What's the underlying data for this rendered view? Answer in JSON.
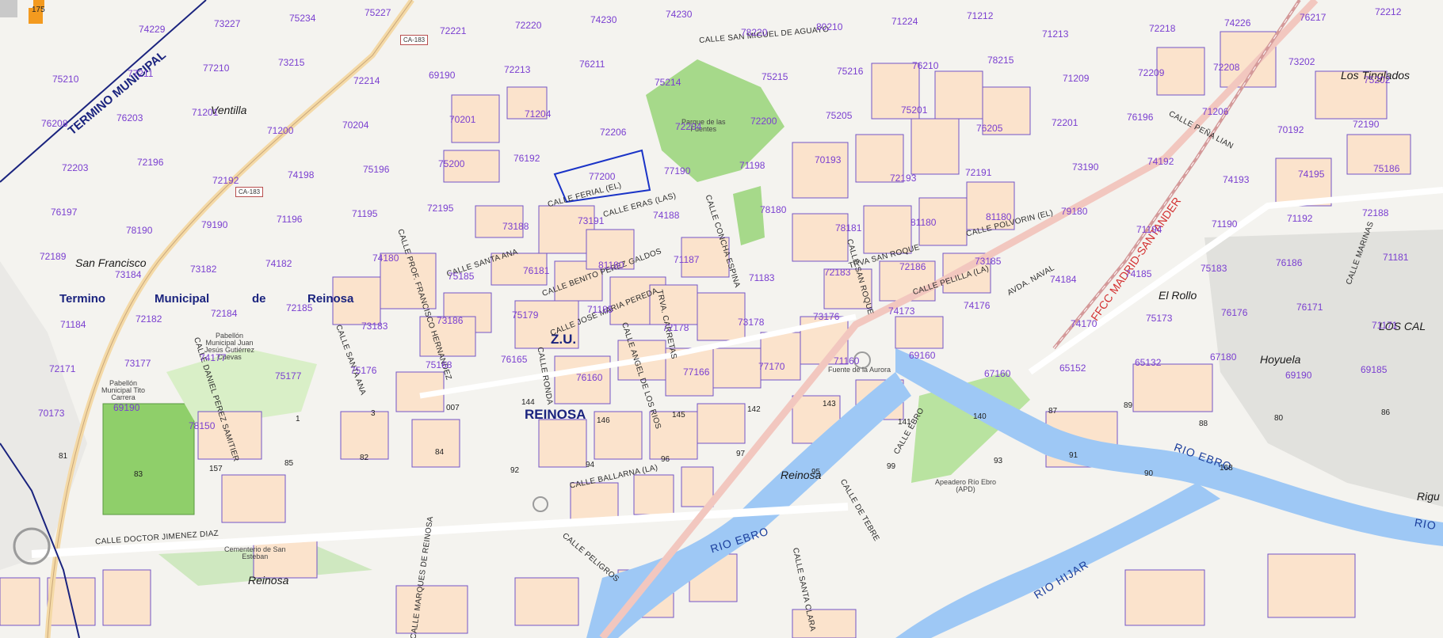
{
  "colors": {
    "background": "#f4f3ef",
    "block": "#fbe3cc",
    "block_stroke": "#7354c7",
    "river": "#9ec8f5",
    "road": "#f2c7bf",
    "park": "#a6d98a",
    "boundary": "#1a237e",
    "rail": "#d32f2f"
  },
  "icons": {
    "map_control": "layers-icon"
  },
  "labels": {
    "boundary": [
      {
        "text": "TERMINO  MUNICIPAL"
      },
      {
        "text": "Termino"
      },
      {
        "text": "Municipal"
      },
      {
        "text": "de"
      },
      {
        "text": "Reinosa"
      }
    ],
    "zones": [
      {
        "text": "Z.U."
      },
      {
        "text": "REINOSA"
      }
    ],
    "places": [
      {
        "text": "Ventilla"
      },
      {
        "text": "San Francisco"
      },
      {
        "text": "Los Tinglados"
      },
      {
        "text": "El Rollo"
      },
      {
        "text": "LOS CAL"
      },
      {
        "text": "Hoyuela"
      },
      {
        "text": "Reinosa"
      },
      {
        "text": "Reinosa"
      },
      {
        "text": "Rigu"
      }
    ],
    "pois": [
      {
        "text": "Parque de las\nFuentes"
      },
      {
        "text": "Pabellón\nMunicipal Juan\nJesús Gutiérrez\nCuevas"
      },
      {
        "text": "Pabellón\nMunicipal Tito\nCarrera"
      },
      {
        "text": "Cementerio de San\nEsteban"
      },
      {
        "text": "Apeadero Río Ebro\n(APD)"
      },
      {
        "text": "Fuente de la Aurora"
      }
    ],
    "rivers": [
      {
        "text": "RIO  EBRO"
      },
      {
        "text": "RIO  EBRO"
      },
      {
        "text": "RIO"
      },
      {
        "text": "RIO   HIJAR"
      },
      {
        "text": "RIO"
      }
    ],
    "rail": [
      {
        "text": "FFCC MADRID-SANTANDER"
      }
    ],
    "badges": [
      {
        "text": "CA-183"
      },
      {
        "text": "CA-183"
      }
    ],
    "streets": [
      {
        "text": "CALLE SAN MIGUEL DE AGUAYO"
      },
      {
        "text": "CALLE FERIAL (EL)"
      },
      {
        "text": "CALLE ERAS (LAS)"
      },
      {
        "text": "CALLE SANTA ANA"
      },
      {
        "text": "CALLE BENITO PEREZ GALDOS"
      },
      {
        "text": "CALLE JOSE MARIA PEREDA"
      },
      {
        "text": "CALLE CONCHA ESPINA"
      },
      {
        "text": "CALLE PROF. FRANCISCO HERNANDEZ"
      },
      {
        "text": "CALLE SANTA ANA"
      },
      {
        "text": "CALLE DANIEL PEREZ SAMITIER"
      },
      {
        "text": "CALLE RONDA"
      },
      {
        "text": "CALLE ANGEL DE LOS RIOS"
      },
      {
        "text": "TRVA. CARRETAS"
      },
      {
        "text": "CALLE SAN ROQUE"
      },
      {
        "text": "TRVA SAN ROQUE"
      },
      {
        "text": "CALLE PELILLA (LA)"
      },
      {
        "text": "CALLE POLVORIN (EL)"
      },
      {
        "text": "AVDA. NAVAL"
      },
      {
        "text": "CALLE PEÑA LIAN"
      },
      {
        "text": "CALLE DOCTOR JIMENEZ DIAZ"
      },
      {
        "text": "CALLE BALLARNA (LA)"
      },
      {
        "text": "CALLE MARQUES DE REINOSA"
      },
      {
        "text": "CALLE EBRO"
      },
      {
        "text": "CALLE DE TEBRE"
      },
      {
        "text": "CALLE PELIGROS"
      },
      {
        "text": "CALLE SANTA CLARA"
      },
      {
        "text": "CALLE MARINAS"
      }
    ],
    "parcels": [
      "175",
      "74229",
      "73227",
      "75234",
      "75227",
      "72221",
      "72220",
      "74230",
      "74230",
      "78220",
      "80210",
      "71224",
      "71212",
      "71213",
      "72218",
      "74226",
      "76217",
      "72212",
      "75210",
      "77211",
      "77210",
      "73215",
      "72214",
      "69190",
      "72213",
      "76211",
      "75214",
      "75215",
      "75216",
      "76210",
      "78215",
      "71209",
      "72209",
      "72208",
      "73202",
      "75202",
      "76208",
      "76203",
      "71201",
      "71200",
      "70204",
      "70201",
      "71204",
      "72206",
      "72204",
      "72200",
      "75205",
      "75201",
      "76205",
      "72201",
      "76196",
      "71206",
      "70192",
      "72190",
      "72203",
      "72196",
      "72192",
      "74198",
      "75196",
      "75200",
      "76192",
      "77200",
      "77190",
      "71198",
      "70193",
      "72193",
      "72191",
      "73190",
      "74192",
      "74193",
      "74195",
      "75186",
      "76197",
      "78190",
      "79190",
      "71196",
      "71195",
      "72195",
      "73188",
      "73191",
      "74188",
      "78180",
      "78181",
      "81180",
      "81180",
      "79180",
      "71194",
      "71190",
      "71192",
      "72188",
      "72189",
      "73184",
      "73182",
      "74182",
      "74180",
      "75185",
      "76181",
      "81180",
      "71187",
      "71183",
      "72183",
      "72186",
      "73185",
      "74184",
      "74185",
      "75183",
      "76186",
      "71181",
      "71184",
      "72182",
      "72184",
      "72185",
      "73183",
      "73186",
      "75179",
      "71185",
      "72178",
      "73178",
      "73176",
      "74173",
      "74176",
      "74170",
      "75173",
      "76176",
      "76171",
      "71171",
      "72171",
      "73177",
      "74177",
      "75177",
      "75176",
      "75168",
      "76165",
      "76160",
      "77166",
      "77170",
      "71160",
      "69160",
      "67160",
      "65152",
      "65132",
      "67180",
      "69190",
      "69185",
      "70173",
      "69190",
      "78150",
      "1",
      "3",
      "007",
      "144",
      "146",
      "145",
      "142",
      "143",
      "141",
      "140",
      "87",
      "89",
      "88",
      "80",
      "86",
      "81",
      "83",
      "157",
      "85",
      "82",
      "84",
      "92",
      "94",
      "96",
      "97",
      "95",
      "99",
      "93",
      "91",
      "90",
      "168"
    ]
  }
}
